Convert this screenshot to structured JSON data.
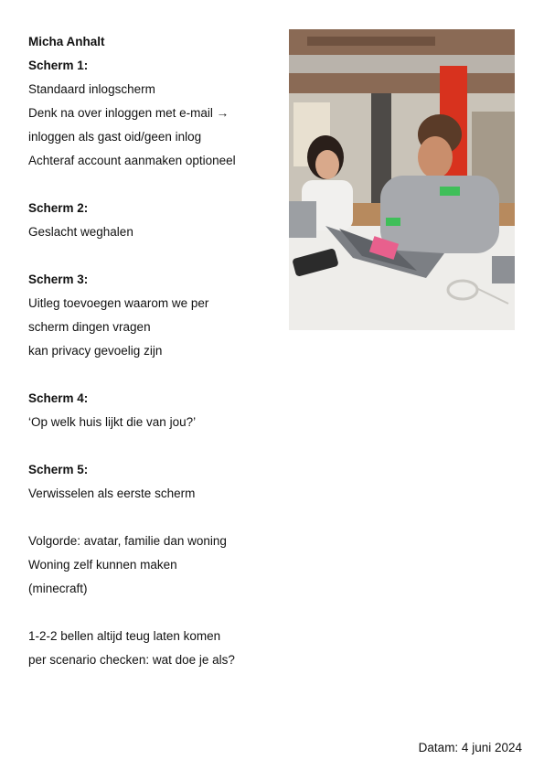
{
  "author": "Micha Anhalt",
  "notes": [
    {
      "heading": "Scherm 1:",
      "lines": [
        "Standaard inlogscherm",
        "Denk na over inloggen met e-mail →",
        "inloggen als gast oid/geen inlog",
        "Achteraf account aanmaken optioneel"
      ]
    },
    {
      "heading": "Scherm 2:",
      "lines": [
        "Geslacht weghalen"
      ]
    },
    {
      "heading": "Scherm 3:",
      "lines": [
        "Uitleg toevoegen waarom we per",
        "scherm dingen vragen",
        "kan privacy gevoelig zijn"
      ]
    },
    {
      "heading": "Scherm 4:",
      "lines": [
        "‘Op welk huis lijkt die van jou?’"
      ]
    },
    {
      "heading": "Scherm 5:",
      "lines": [
        "Verwisselen als eerste scherm"
      ]
    },
    {
      "heading": "",
      "lines": [
        "Volgorde: avatar, familie dan woning",
        "Woning zelf kunnen maken",
        "(minecraft)"
      ]
    },
    {
      "heading": "",
      "lines": [
        "1-2-2 bellen altijd teug laten komen",
        "per scenario checken: wat doe je als?"
      ]
    }
  ],
  "date": "Datam: 4 juni 2024"
}
